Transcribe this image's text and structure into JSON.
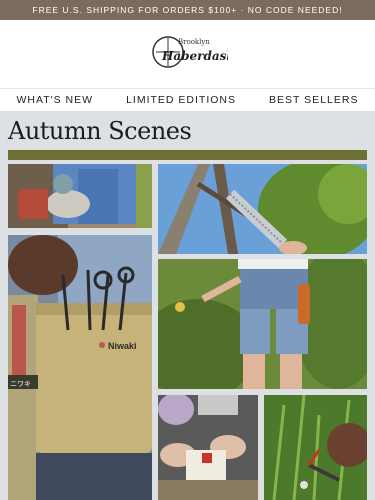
{
  "banner": {
    "text": "FREE U.S. SHIPPING FOR ORDERS $100+ · NO CODE NEEDED!"
  },
  "logo": {
    "line1": "Brooklyn",
    "line2": "Haberdashery"
  },
  "nav": {
    "items": [
      "WHAT'S NEW",
      "LIMITED EDITIONS",
      "BEST SELLERS"
    ]
  },
  "section": {
    "title": "Autumn Scenes"
  },
  "photos": {
    "bag_brand": "Niwaki",
    "bag_jp": "ニワキ"
  },
  "colors": {
    "banner": "#7b6a5e",
    "hero_bg": "#dde1e4",
    "accent_bar": "#6d7035"
  }
}
